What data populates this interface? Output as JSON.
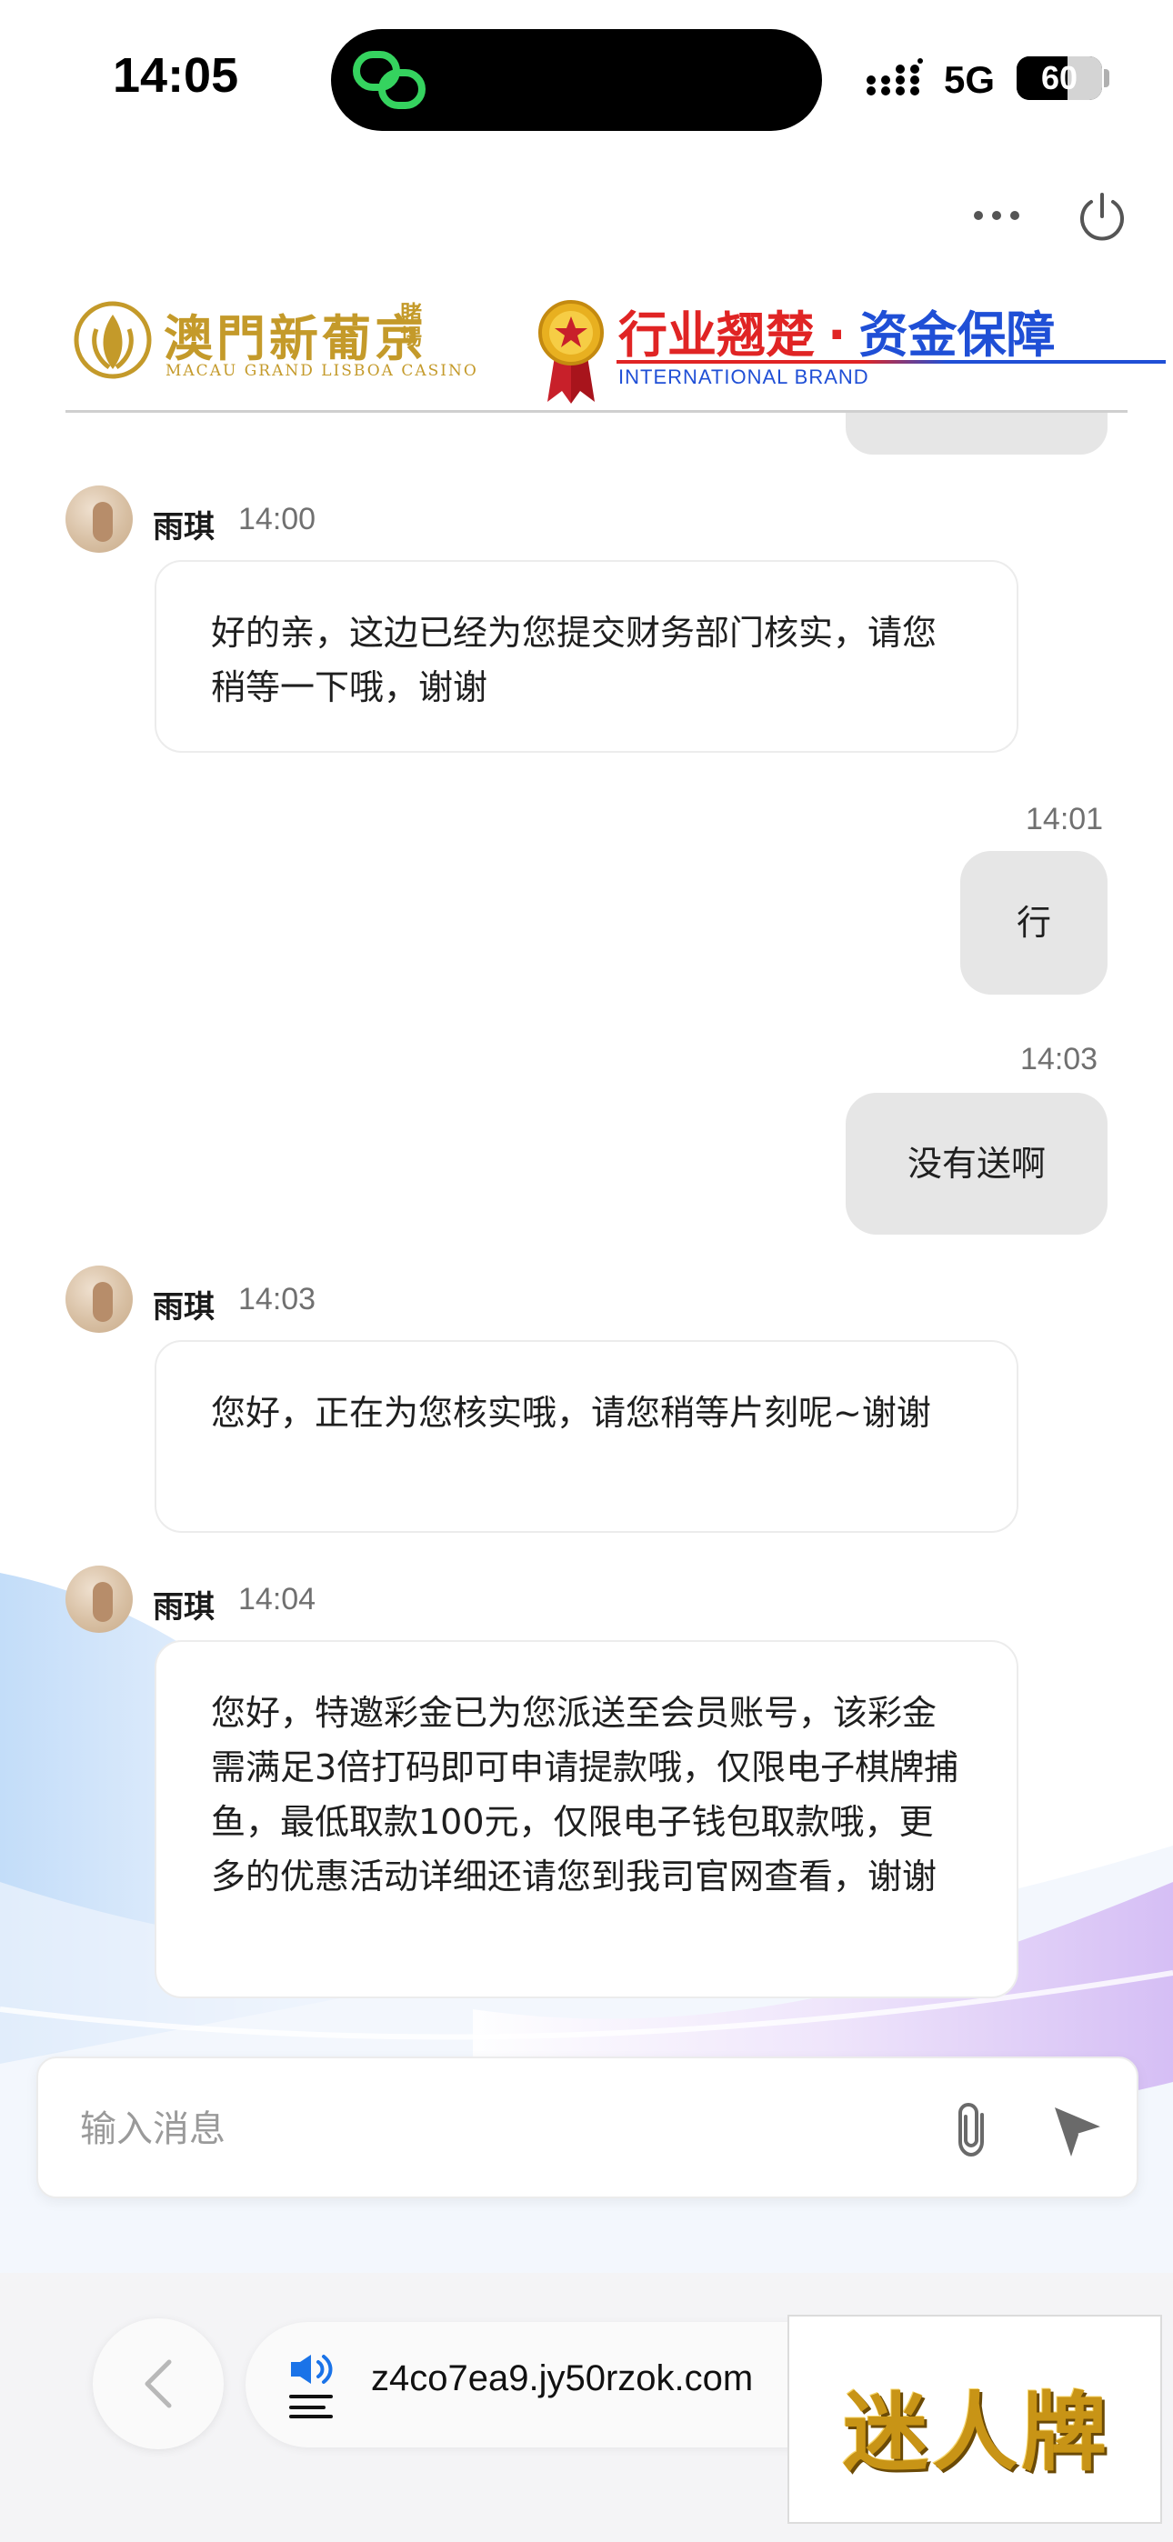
{
  "status_bar": {
    "time": "14:05",
    "network": "5G",
    "battery_level": "60",
    "battery_fraction": 0.6
  },
  "banner": {
    "casino_name": "澳門新葡京",
    "casino_suffix": "賭場",
    "casino_subtitle": "MACAU GRAND LISBOA CASINO",
    "slogan_left": "行业翘楚",
    "slogan_dot": "·",
    "slogan_right": "资金保障",
    "slogan_sub": "INTERNATIONAL BRAND"
  },
  "messages": [
    {
      "direction": "incoming",
      "sender": "雨琪",
      "time": "14:00",
      "text": "好的亲，这边已经为您提交财务部门核实，请您稍等一下哦，谢谢"
    },
    {
      "direction": "outgoing",
      "time": "14:01",
      "text": "行"
    },
    {
      "direction": "outgoing",
      "time": "14:03",
      "text": "没有送啊"
    },
    {
      "direction": "incoming",
      "sender": "雨琪",
      "time": "14:03",
      "text": "您好，正在为您核实哦，请您稍等片刻呢~谢谢"
    },
    {
      "direction": "incoming",
      "sender": "雨琪",
      "time": "14:04",
      "text": "您好，特邀彩金已为您派送至会员账号，该彩金需满足3倍打码即可申请提款哦，仅限电子棋牌捕鱼，最低取款100元，仅限电子钱包取款哦，更多的优惠活动详细还请您到我司官网查看，谢谢"
    }
  ],
  "input": {
    "placeholder": "输入消息"
  },
  "browser": {
    "url": "z4co7ea9.jy50rzok.com"
  },
  "sticker": {
    "text": "迷人牌"
  },
  "colors": {
    "accent_gold": "#c49a2a",
    "slogan_red": "#e02424",
    "slogan_blue": "#1f4fd6",
    "outgoing_bubble": "#e6e6e6",
    "island_icon": "#35d35f"
  },
  "icons": {
    "island": "link-rings-icon",
    "more": "more-dots-icon",
    "power": "power-icon",
    "attach": "paperclip-icon",
    "send": "send-arrow-icon",
    "back": "chevron-left-icon",
    "speaker": "speaker-icon"
  }
}
